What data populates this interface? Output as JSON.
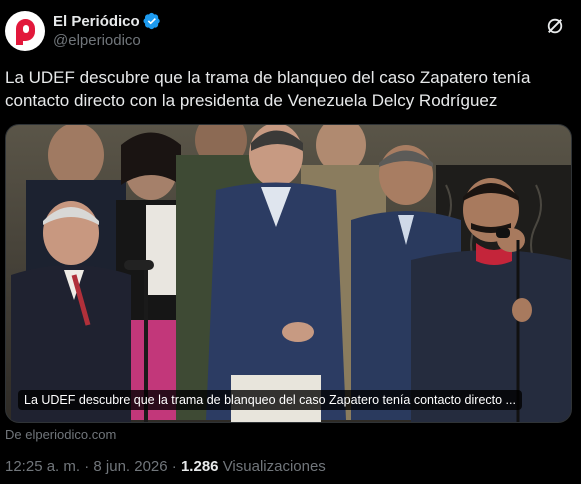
{
  "author": {
    "display_name": "El Periódico",
    "handle": "@elperiodico"
  },
  "tweet": {
    "text": "La UDEF descubre que la trama de blanqueo del caso Zapatero tenía contacto directo con la presidenta de Venezuela Delcy Rodríguez"
  },
  "card": {
    "caption": "La UDEF descubre que la trama de blanqueo del caso Zapatero tenía contacto directo ...",
    "source": "De elperiodico.com"
  },
  "meta": {
    "time": "12:25 a. m.",
    "separator": "·",
    "date": "8 jun. 2026",
    "views_count": "1.286",
    "views_label": "Visualizaciones"
  },
  "colors": {
    "background": "#000000",
    "verified": "#1d9bf0",
    "brand_red": "#e2183b"
  },
  "icons": [
    "verified-badge-icon",
    "grok-icon",
    "more-icon"
  ]
}
